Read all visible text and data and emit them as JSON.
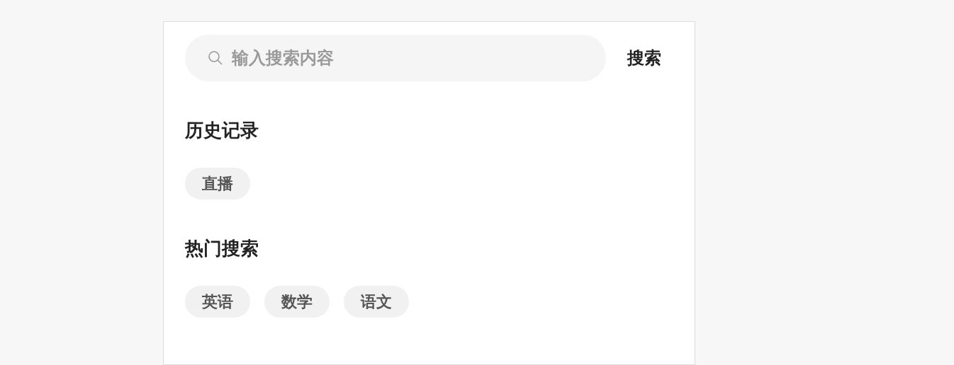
{
  "search": {
    "placeholder": "输入搜索内容",
    "button": "搜索"
  },
  "sections": [
    {
      "title": "历史记录",
      "tags": [
        "直播"
      ]
    },
    {
      "title": "热门搜索",
      "tags": [
        "英语",
        "数学",
        "语文"
      ]
    }
  ]
}
